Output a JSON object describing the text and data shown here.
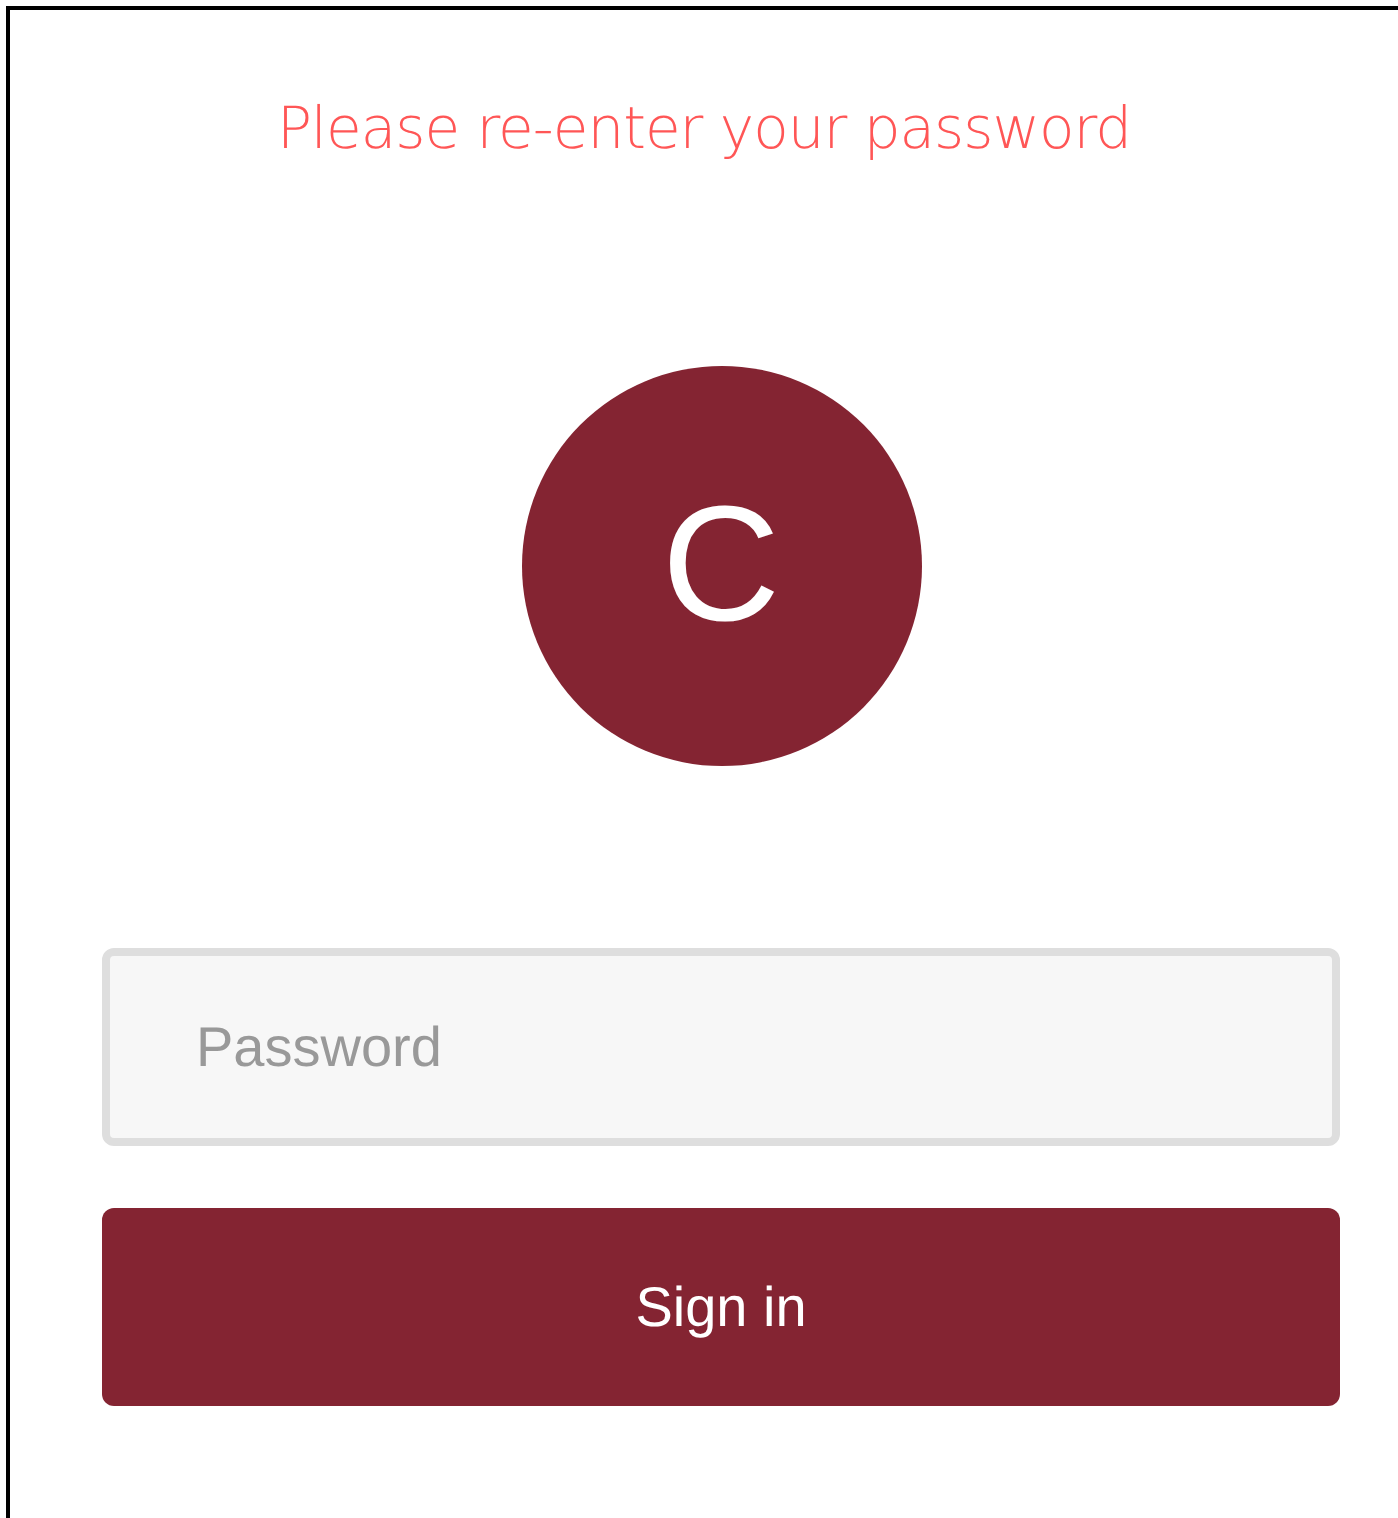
{
  "message": "Please re-enter your password",
  "avatar": {
    "initial": "C"
  },
  "password_field": {
    "placeholder": "Password"
  },
  "sign_in_button": {
    "label": "Sign in"
  }
}
